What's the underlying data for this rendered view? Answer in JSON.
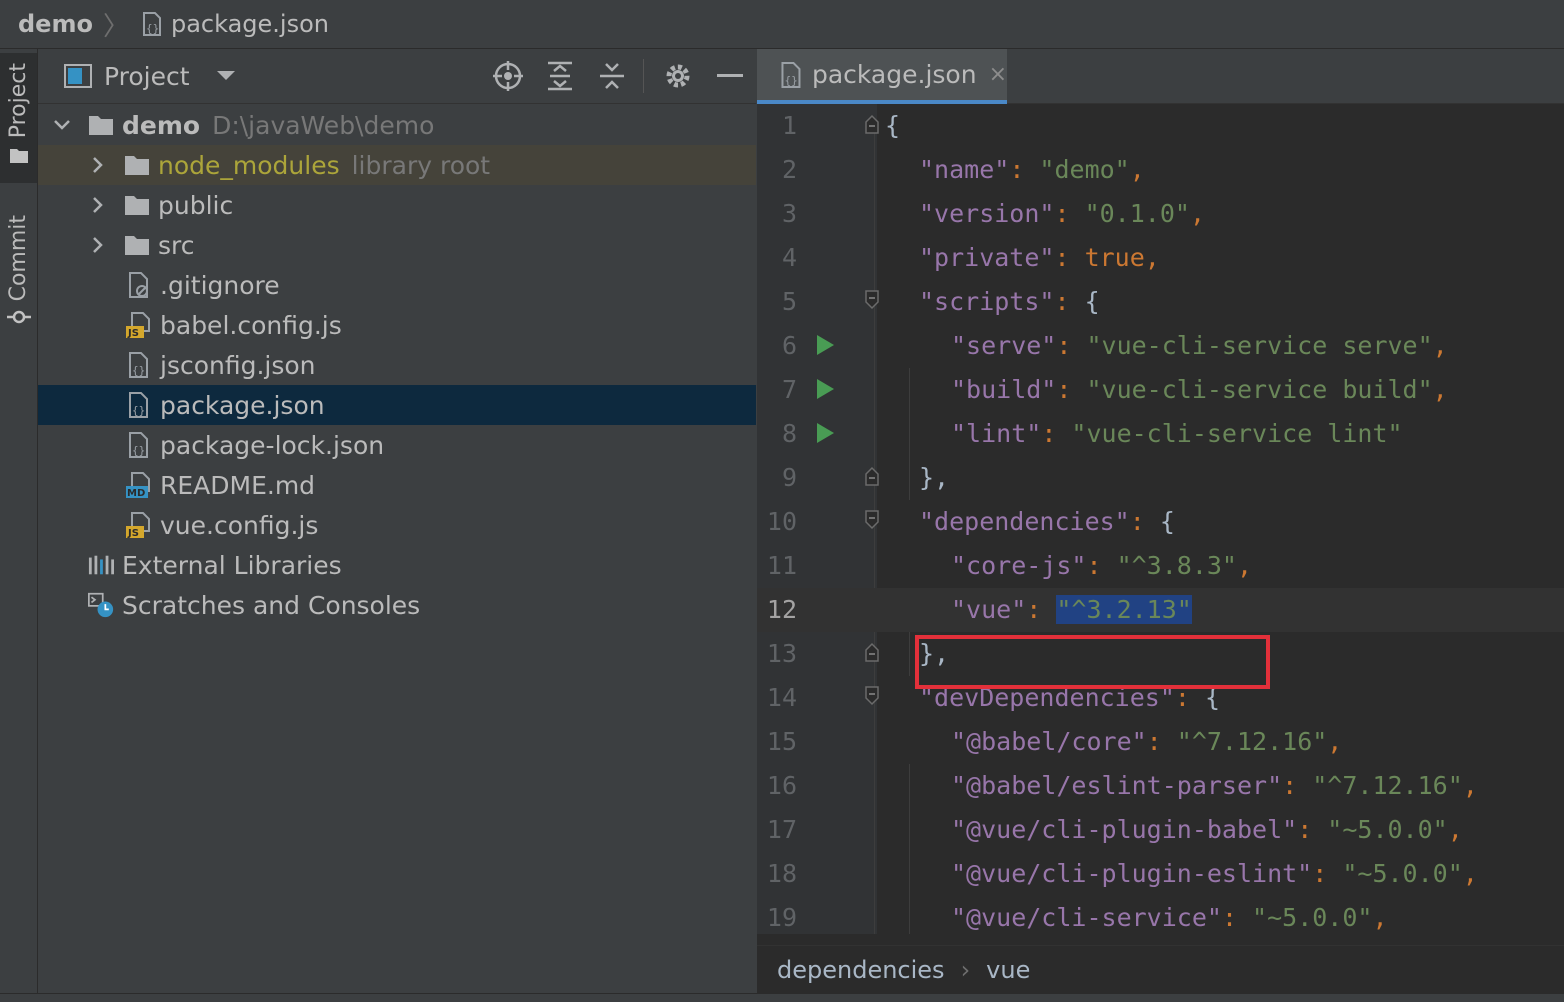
{
  "breadcrumb": {
    "root": "demo",
    "file": "package.json"
  },
  "left_strip": {
    "project_tab": "Project",
    "commit_tab": "Commit"
  },
  "project_panel": {
    "title": "Project",
    "tree": [
      {
        "label": "demo",
        "hint": "D:\\javaWeb\\demo",
        "type": "folder",
        "expanded": true
      },
      {
        "label": "node_modules",
        "hint": "library root",
        "type": "folder"
      },
      {
        "label": "public",
        "type": "folder"
      },
      {
        "label": "src",
        "type": "folder"
      },
      {
        "label": ".gitignore",
        "type": "gitignore"
      },
      {
        "label": "babel.config.js",
        "type": "js",
        "badge": "JS"
      },
      {
        "label": "jsconfig.json",
        "type": "json"
      },
      {
        "label": "package.json",
        "type": "json",
        "selected": true
      },
      {
        "label": "package-lock.json",
        "type": "json"
      },
      {
        "label": "README.md",
        "type": "md",
        "badge": "MD"
      },
      {
        "label": "vue.config.js",
        "type": "js",
        "badge": "JS"
      },
      {
        "label": "External Libraries",
        "type": "libraries"
      },
      {
        "label": "Scratches and Consoles",
        "type": "scratches"
      }
    ]
  },
  "editor": {
    "tab_label": "package.json",
    "tab_close": "×",
    "current_line": 12,
    "lines": [
      {
        "n": "1"
      },
      {
        "n": "2"
      },
      {
        "n": "3"
      },
      {
        "n": "4"
      },
      {
        "n": "5"
      },
      {
        "n": "6"
      },
      {
        "n": "7"
      },
      {
        "n": "8"
      },
      {
        "n": "9"
      },
      {
        "n": "10"
      },
      {
        "n": "11"
      },
      {
        "n": "12"
      },
      {
        "n": "13"
      },
      {
        "n": "14"
      },
      {
        "n": "15"
      },
      {
        "n": "16"
      },
      {
        "n": "17"
      },
      {
        "n": "18"
      },
      {
        "n": "19"
      }
    ],
    "tokens": {
      "l1": "{",
      "l2k": "\"name\"",
      "l2v": "\"demo\"",
      "l3k": "\"version\"",
      "l3v": "\"0.1.0\"",
      "l4k": "\"private\"",
      "l4v": "true",
      "l5k": "\"scripts\"",
      "l5v": "{",
      "l6k": "\"serve\"",
      "l6v": "\"vue-cli-service serve\"",
      "l7k": "\"build\"",
      "l7v": "\"vue-cli-service build\"",
      "l8k": "\"lint\"",
      "l8v": "\"vue-cli-service lint\"",
      "l9": "},",
      "l10k": "\"dependencies\"",
      "l10v": "{",
      "l11k": "\"core-js\"",
      "l11v": "\"^3.8.3\"",
      "l12k": "\"vue\"",
      "l12v": "\"^3.2.13\"",
      "l13": "},",
      "l14k": "\"devDependencies\"",
      "l14v": "{",
      "l15k": "\"@babel/core\"",
      "l15v": "\"^7.12.16\"",
      "l16k": "\"@babel/eslint-parser\"",
      "l16v": "\"^7.12.16\"",
      "l17k": "\"@vue/cli-plugin-babel\"",
      "l17v": "\"~5.0.0\"",
      "l18k": "\"@vue/cli-plugin-eslint\"",
      "l18v": "\"~5.0.0\"",
      "l19k": "\"@vue/cli-service\"",
      "l19v": "\"~5.0.0\""
    },
    "breadcrumb": [
      "dependencies",
      "vue"
    ]
  },
  "colors": {
    "key": "#9876aa",
    "string": "#6a8759",
    "keyword": "#cc7832",
    "selection": "#214283",
    "highlight_box": "#e3303a",
    "run_icon": "#499c54"
  },
  "icons": {
    "locate": "crosshair-icon",
    "expand": "expand-all-icon",
    "collapse": "collapse-all-icon",
    "settings": "gear-icon",
    "hide": "minimize-icon"
  }
}
